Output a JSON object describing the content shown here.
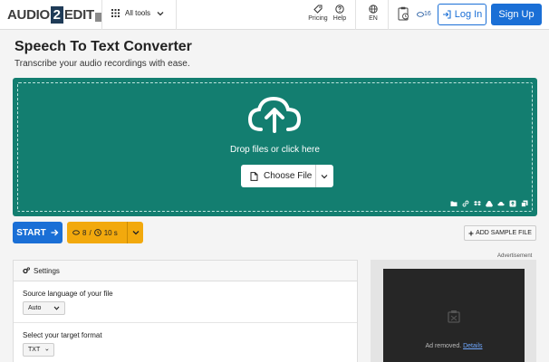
{
  "header": {
    "logo": {
      "part1": "AUDIO",
      "part2": "2",
      "part3": "EDIT"
    },
    "all_tools": "All tools",
    "pricing": "Pricing",
    "help": "Help",
    "language": "EN",
    "clipboard_count": "16",
    "login": "Log In",
    "signup": "Sign Up"
  },
  "main": {
    "title": "Speech To Text Converter",
    "subtitle": "Transcribe your audio recordings with ease.",
    "dropzone": {
      "text": "Drop files or click here",
      "choose_file": "Choose File",
      "sources": [
        "folder-icon",
        "link-icon",
        "dropbox-icon",
        "google-drive-icon",
        "onedrive-icon",
        "upload-icon",
        "copy-icon"
      ]
    },
    "start": "START",
    "limits": {
      "files": "8",
      "separator": "/",
      "duration": "10 s"
    },
    "add_sample": "ADD SAMPLE FILE"
  },
  "settings": {
    "title": "Settings",
    "source_label": "Source language of your file",
    "source_value": "Auto",
    "target_label": "Select your target format",
    "target_value": "TXT"
  },
  "ad": {
    "label": "Advertisement",
    "removed": "Ad removed.",
    "details": "Details"
  },
  "colors": {
    "accent": "#1a6fd6",
    "dropzone": "#137e70",
    "limits": "#f2a90d"
  }
}
